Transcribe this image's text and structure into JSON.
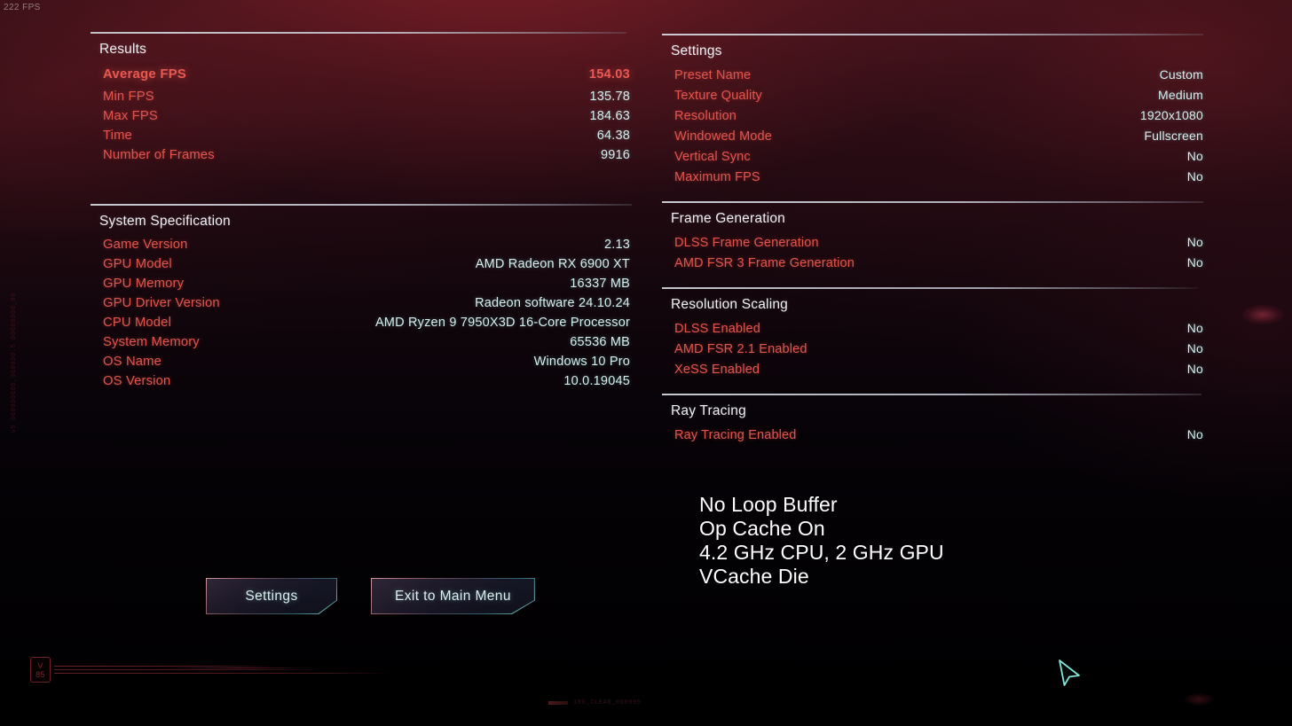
{
  "hud": {
    "fps_counter": "222 FPS",
    "version_badge_line1": "V",
    "version_badge_line2": "85",
    "vertical_code": "v5 000000005_000000.5 00000000_00",
    "bottom_code": "180_CLEAR_000095"
  },
  "colors": {
    "label": "#e0564f",
    "value": "#d3eeee",
    "header": "#eef0f4",
    "accent_red": "#e85a51",
    "cursor": "#7fe6d8"
  },
  "left_panel": {
    "results": {
      "title": "Results",
      "hero": {
        "label": "Average FPS",
        "value": "154.03"
      },
      "rows": [
        {
          "label": "Min FPS",
          "value": "135.78"
        },
        {
          "label": "Max FPS",
          "value": "184.63"
        },
        {
          "label": "Time",
          "value": "64.38"
        },
        {
          "label": "Number of Frames",
          "value": "9916"
        }
      ]
    },
    "system_specification": {
      "title": "System Specification",
      "rows": [
        {
          "label": "Game Version",
          "value": "2.13"
        },
        {
          "label": "GPU Model",
          "value": "AMD Radeon RX 6900 XT"
        },
        {
          "label": "GPU Memory",
          "value": "16337 MB"
        },
        {
          "label": "GPU Driver Version",
          "value": "Radeon software 24.10.24"
        },
        {
          "label": "CPU Model",
          "value": "AMD Ryzen 9 7950X3D 16-Core Processor"
        },
        {
          "label": "System Memory",
          "value": "65536 MB"
        },
        {
          "label": "OS Name",
          "value": "Windows 10 Pro"
        },
        {
          "label": "OS Version",
          "value": "10.0.19045"
        }
      ]
    }
  },
  "right_panel": {
    "settings": {
      "title": "Settings",
      "rows": [
        {
          "label": "Preset Name",
          "value": "Custom"
        },
        {
          "label": "Texture Quality",
          "value": "Medium"
        },
        {
          "label": "Resolution",
          "value": "1920x1080"
        },
        {
          "label": "Windowed Mode",
          "value": "Fullscreen"
        },
        {
          "label": "Vertical Sync",
          "value": "No"
        },
        {
          "label": "Maximum FPS",
          "value": "No"
        }
      ]
    },
    "frame_generation": {
      "title": "Frame Generation",
      "rows": [
        {
          "label": "DLSS Frame Generation",
          "value": "No"
        },
        {
          "label": "AMD FSR 3 Frame Generation",
          "value": "No"
        }
      ]
    },
    "resolution_scaling": {
      "title": "Resolution Scaling",
      "rows": [
        {
          "label": "DLSS Enabled",
          "value": "No"
        },
        {
          "label": "AMD FSR 2.1 Enabled",
          "value": "No"
        },
        {
          "label": "XeSS Enabled",
          "value": "No"
        }
      ]
    },
    "ray_tracing": {
      "title": "Ray Tracing",
      "rows": [
        {
          "label": "Ray Tracing Enabled",
          "value": "No"
        }
      ]
    }
  },
  "buttons": {
    "settings": "Settings",
    "exit_to_main_menu": "Exit to Main Menu"
  },
  "note_overlay": {
    "lines": [
      "No Loop Buffer",
      "Op Cache On",
      "4.2 GHz CPU, 2 GHz GPU",
      "VCache Die"
    ]
  }
}
